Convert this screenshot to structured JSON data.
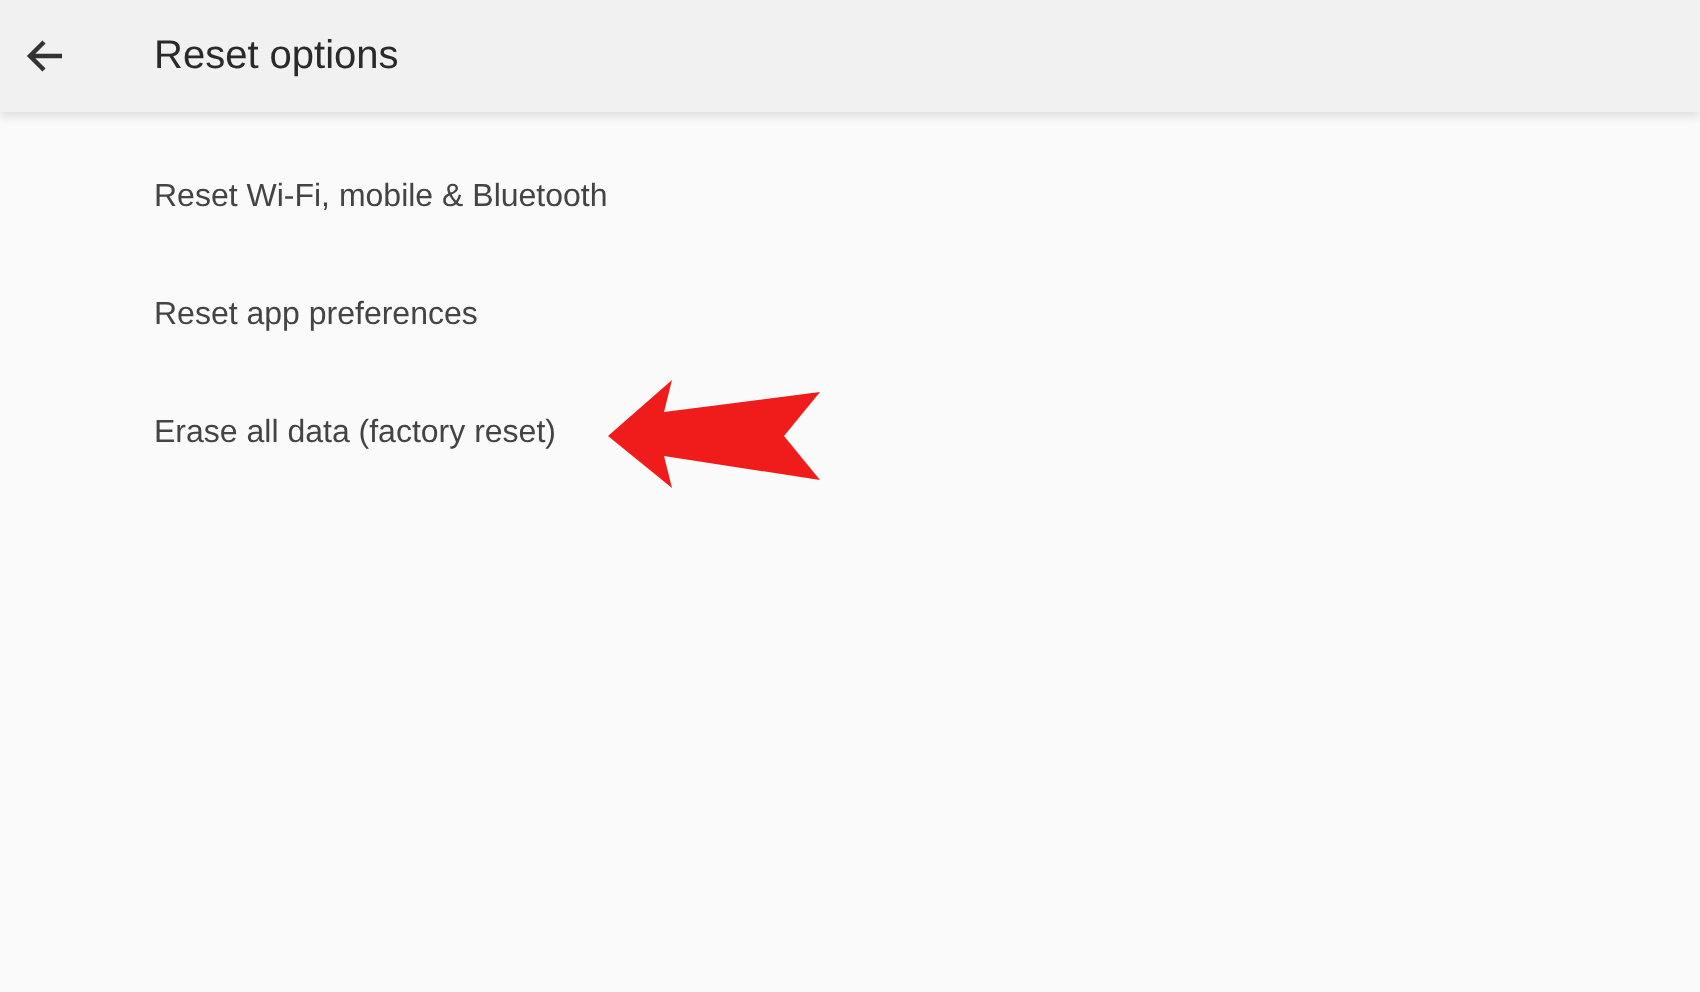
{
  "header": {
    "title": "Reset options"
  },
  "items": [
    {
      "label": "Reset Wi-Fi, mobile & Bluetooth",
      "pointed_at": false
    },
    {
      "label": "Reset app preferences",
      "pointed_at": false
    },
    {
      "label": "Erase all data (factory reset)",
      "pointed_at": true
    }
  ]
}
